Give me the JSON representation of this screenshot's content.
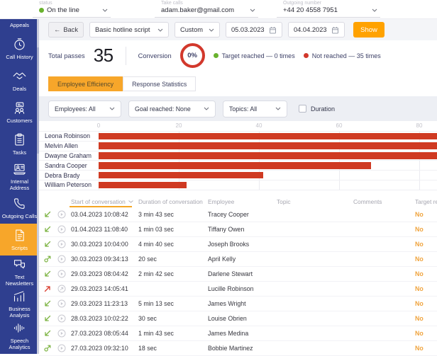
{
  "topbar": {
    "status": {
      "label": "status",
      "value": "On the line"
    },
    "take_calls": {
      "label": "Take calls",
      "value": "adam.baker@gmail.com"
    },
    "outgoing_number": {
      "label": "Outgoing number",
      "value": "+44 20 4558 7951"
    }
  },
  "sidebar": {
    "items": [
      {
        "id": "appeals",
        "label": "Appeals",
        "icon": null,
        "active": false
      },
      {
        "id": "call-history",
        "label": "Call History",
        "icon": "clock",
        "active": false
      },
      {
        "id": "deals",
        "label": "Deals",
        "icon": "handshake",
        "active": false
      },
      {
        "id": "customers",
        "label": "Customers",
        "icon": "people",
        "active": false
      },
      {
        "id": "tasks",
        "label": "Tasks",
        "icon": "clipboard",
        "active": false
      },
      {
        "id": "internal-address",
        "label": "Internal Address",
        "icon": "laptop-user",
        "active": false
      },
      {
        "id": "outgoing-calls",
        "label": "Outgoing Calls",
        "icon": "phone",
        "active": false
      },
      {
        "id": "scripts",
        "label": "Scripts",
        "icon": "document",
        "active": true
      },
      {
        "id": "text-newsletters",
        "label": "Text Newsletters",
        "icon": "chat-bubbles",
        "active": false
      },
      {
        "id": "business-analysis",
        "label": "Business Analysis",
        "icon": "chart-growth",
        "active": false
      },
      {
        "id": "speech-analytics",
        "label": "Speech Analytics",
        "icon": "waveform",
        "active": false
      }
    ]
  },
  "toolbar": {
    "back": "Back",
    "script_select": "Basic hotline script",
    "period_select": "Custom",
    "date_from": "05.03.2023",
    "date_to": "04.04.2023",
    "show": "Show"
  },
  "stats": {
    "total_passes_label": "Total passes",
    "total_passes": "35",
    "conversion_label": "Conversion",
    "conversion": "0%",
    "legend": [
      {
        "label": "Target reached — 0 times",
        "color": "#69b22e"
      },
      {
        "label": "Not reached — 35 times",
        "color": "#d2382c"
      }
    ]
  },
  "tabs": [
    {
      "label": "Employee Efficiency",
      "active": true
    },
    {
      "label": "Response Statistics",
      "active": false
    }
  ],
  "filters": {
    "employees": "Employees: All",
    "goal_reached": "Goal reached: None",
    "topics": "Topics: All",
    "duration_label": "Duration",
    "duration_checked": false
  },
  "chart_data": {
    "type": "bar",
    "orientation": "horizontal",
    "title": "",
    "xlabel": "",
    "ylabel": "",
    "categories": [
      "Leona Robinson",
      "Melvin Allen",
      "Dwayne Graham",
      "Sandra Cooper",
      "Debra Brady",
      "William Peterson"
    ],
    "values": [
      100,
      100,
      100,
      68,
      41,
      22
    ],
    "xticks": [
      0,
      20,
      40,
      60,
      80
    ],
    "xlim": [
      0,
      84
    ],
    "bar_color": "#cf3a22",
    "grid": true,
    "legend_position": "none"
  },
  "table": {
    "columns": [
      "Start of conversation",
      "Duration of conversation",
      "Employee",
      "Topic",
      "Comments",
      "Target reached"
    ],
    "sort_column": "Start of conversation",
    "rows": [
      {
        "direction": "incoming",
        "record": "play",
        "start": "03.04.2023 10:08:42",
        "duration": "3 min 43 sec",
        "employee": "Tracey Cooper",
        "topic": "",
        "comments": "",
        "target": "No"
      },
      {
        "direction": "incoming",
        "record": "play",
        "start": "01.04.2023 11:08:40",
        "duration": "1 min 03 sec",
        "employee": "Tiffany Owen",
        "topic": "",
        "comments": "",
        "target": "No"
      },
      {
        "direction": "incoming",
        "record": "play",
        "start": "30.03.2023 10:04:00",
        "duration": "4 min 40 sec",
        "employee": "Joseph Brooks",
        "topic": "",
        "comments": "",
        "target": "No"
      },
      {
        "direction": "outgoing",
        "record": "play",
        "start": "30.03.2023 09:34:13",
        "duration": "20 sec",
        "employee": "April Kelly",
        "topic": "",
        "comments": "",
        "target": "No"
      },
      {
        "direction": "incoming",
        "record": "play",
        "start": "29.03.2023 08:04:42",
        "duration": "2 min 42 sec",
        "employee": "Darlene Stewart",
        "topic": "",
        "comments": "",
        "target": "No"
      },
      {
        "direction": "missed-outgoing",
        "record": "no-record",
        "start": "29.03.2023 14:05:41",
        "duration": "",
        "employee": "Lucille Robinson",
        "topic": "",
        "comments": "",
        "target": "No"
      },
      {
        "direction": "incoming",
        "record": "play",
        "start": "29.03.2023 11:23:13",
        "duration": "5 min 13 sec",
        "employee": "James Wright",
        "topic": "",
        "comments": "",
        "target": "No"
      },
      {
        "direction": "incoming",
        "record": "play",
        "start": "28.03.2023 10:02:22",
        "duration": "30 sec",
        "employee": "Louise Obrien",
        "topic": "",
        "comments": "",
        "target": "No"
      },
      {
        "direction": "incoming",
        "record": "play",
        "start": "27.03.2023 08:05:44",
        "duration": "1 min 43 sec",
        "employee": "James Medina",
        "topic": "",
        "comments": "",
        "target": "No"
      },
      {
        "direction": "outgoing",
        "record": "play",
        "start": "27.03.2023 09:32:10",
        "duration": "18 sec",
        "employee": "Bobbie Martinez",
        "topic": "",
        "comments": "",
        "target": "No"
      }
    ]
  },
  "colors": {
    "sidebar_blue": "#2f3f8f",
    "accent_orange": "#f7a62a",
    "show_button_orange": "#ffa200",
    "bar_red": "#cf3a22",
    "target_no_orange": "#f0a43e",
    "navy_text": "#3b3f66",
    "green": "#69b22e",
    "red": "#d2382c"
  }
}
